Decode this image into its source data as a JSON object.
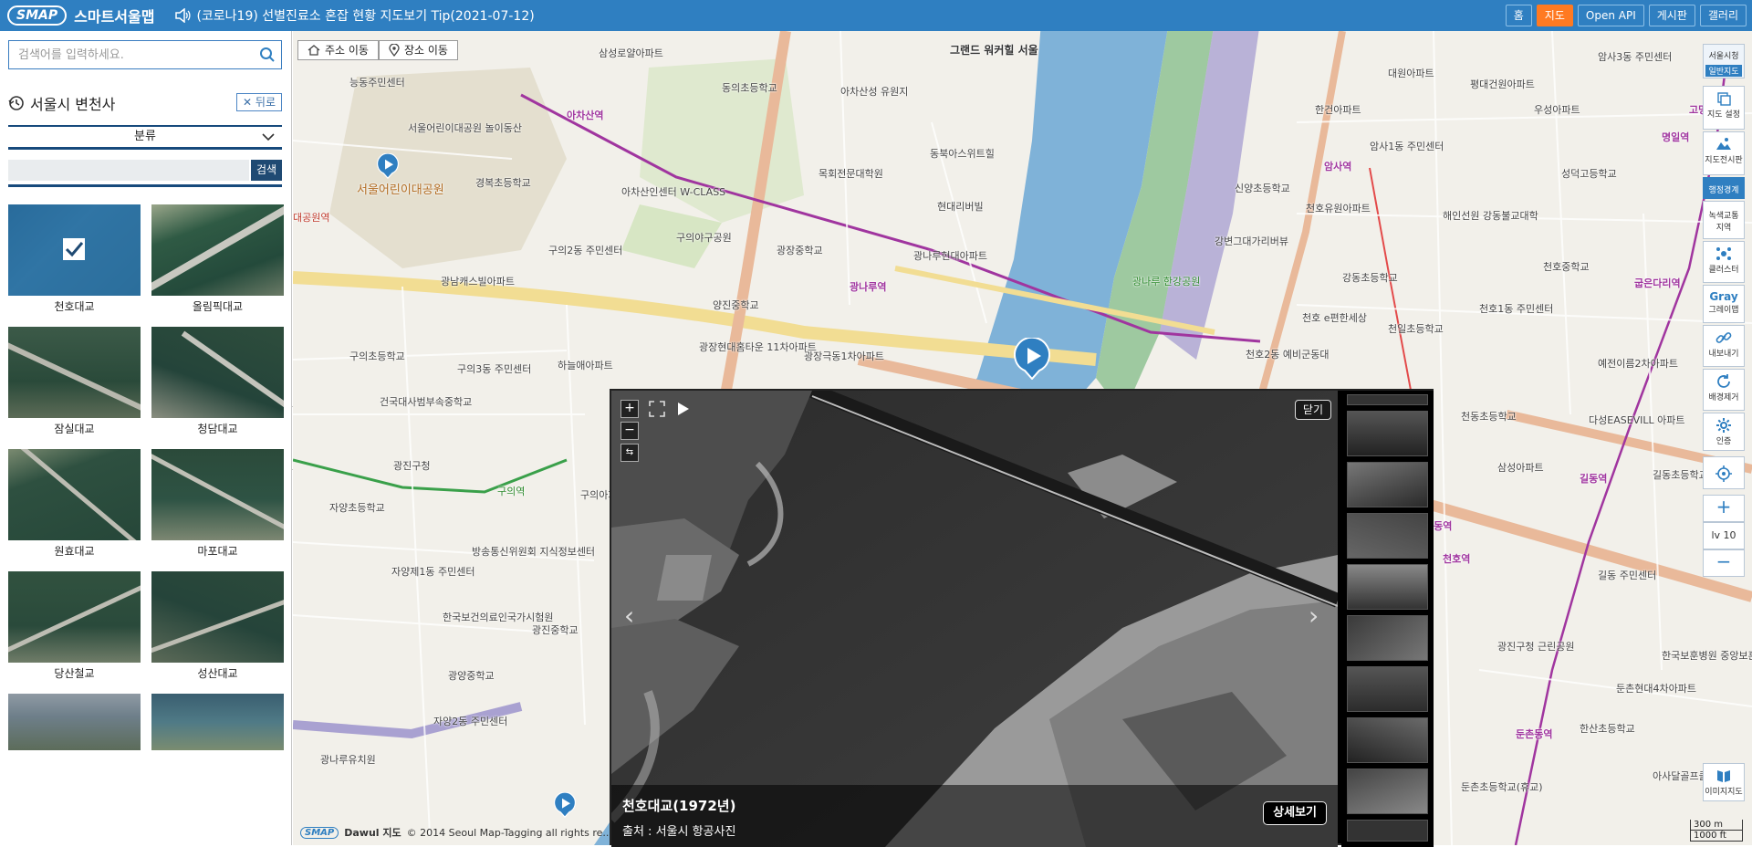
{
  "header": {
    "logo_badge": "SMAP",
    "logo_text": "스마트서울맵",
    "notice": "(코로나19) 선별진료소 혼잡 현황 지도보기 Tip(2021-07-12)",
    "nav": [
      "홈",
      "지도",
      "Open API",
      "게시판",
      "갤러리"
    ]
  },
  "sidebar": {
    "search_placeholder": "검색어를 입력하세요.",
    "section_title": "서울시 변천사",
    "back_label": "뒤로",
    "category_label": "분류",
    "search_button": "검색",
    "thumbnails": [
      {
        "label": "천호대교"
      },
      {
        "label": "올림픽대교"
      },
      {
        "label": "잠실대교"
      },
      {
        "label": "청담대교"
      },
      {
        "label": "원효대교"
      },
      {
        "label": "마포대교"
      },
      {
        "label": "당산철교"
      },
      {
        "label": "성산대교"
      },
      {
        "label": ""
      },
      {
        "label": ""
      }
    ]
  },
  "map": {
    "tabs": [
      "주소 이동",
      "장소 이동"
    ],
    "labels": [
      "능동주민센터",
      "아차산역",
      "삼성로얄아파트",
      "동의초등학교",
      "아차산성 유원지",
      "그랜드 워커힐 서울",
      "서울어린이대공원 놀이동산",
      "서울어린이대공원",
      "경복초등학교",
      "목회전문대학원",
      "동북아스위트힐",
      "아차산인센터 W-CLASS",
      "광남캐스빌아파트",
      "구의2동 주민센터",
      "구의야구공원",
      "광장중학교",
      "현대리버빌",
      "광나루현대아파트",
      "광나루역",
      "양진중학교",
      "광장현대홈타운 11차아파트",
      "광장극동1차아파트",
      "하늘애아파트",
      "구의3동 주민센터",
      "구의초등학교",
      "건국대사범부속중학교",
      "광진구청",
      "구의역",
      "자양초등학교",
      "자양제1동 주민센터",
      "방송통신위원회 지식정보센터",
      "한국보건의료인국가시험원",
      "광진중학교",
      "광양중학교",
      "자양2동 주민센터",
      "대공원역",
      "광나루유치원",
      "광나루 한강공원",
      "신양초등학교",
      "강변그대가리버뷰",
      "천호 e편한세상",
      "천호2동 예비군동대",
      "암사1동 주민센터",
      "암사역",
      "천호유원아파트",
      "한건아파트",
      "해인선원 강동불교대학",
      "강동초등학교",
      "천호중학교",
      "천호1동 주민센터",
      "천일초등학교",
      "성덕고등학교",
      "명일역",
      "굽은다리역",
      "예전이름2차아파트",
      "다성EASEVILL 아파트",
      "천동초등학교",
      "길동역",
      "길동초등학교",
      "강동역",
      "길동 주민센터",
      "둔촌동역",
      "한산초등학교",
      "둔촌초등학교(휴교)",
      "우성아파트",
      "암사3동 주민센터",
      "평대건원아파트",
      "대원아파트",
      "고명",
      "삼성아파트",
      "광진구청 근린공원",
      "둔촌현대4차아파트",
      "천호역",
      "한국보훈병원 중앙보훈",
      "아사달골프클럽",
      "구의아파트"
    ]
  },
  "viewer": {
    "close_label": "닫기",
    "title": "천호대교(1972년)",
    "source": "출처 : 서울시 항공사진",
    "detail_label": "상세보기"
  },
  "toolbar": {
    "items": [
      "서울시청",
      "일반지도",
      "지도 설정",
      "지도전시판",
      "행정경계",
      "녹색교통지역",
      "클러스터",
      "Gray",
      "그레이맵",
      "내보내기",
      "배경제거",
      "인증",
      "lv 10",
      "이미지지도"
    ]
  },
  "footer": {
    "copyright": "© 2014 Seoul Map-Tagging all rights re...",
    "brand_badge": "SMAP",
    "brand_text": "Dawul",
    "brand_suffix": "지도",
    "scale_m": "300 m",
    "scale_ft": "1000 ft"
  },
  "colors": {
    "brand_blue": "#2f7fc1",
    "nav_active": "#ff7a22",
    "dark_navy": "#174a7c",
    "river": "#7fb2d8",
    "subway_line": "#a0359f"
  }
}
